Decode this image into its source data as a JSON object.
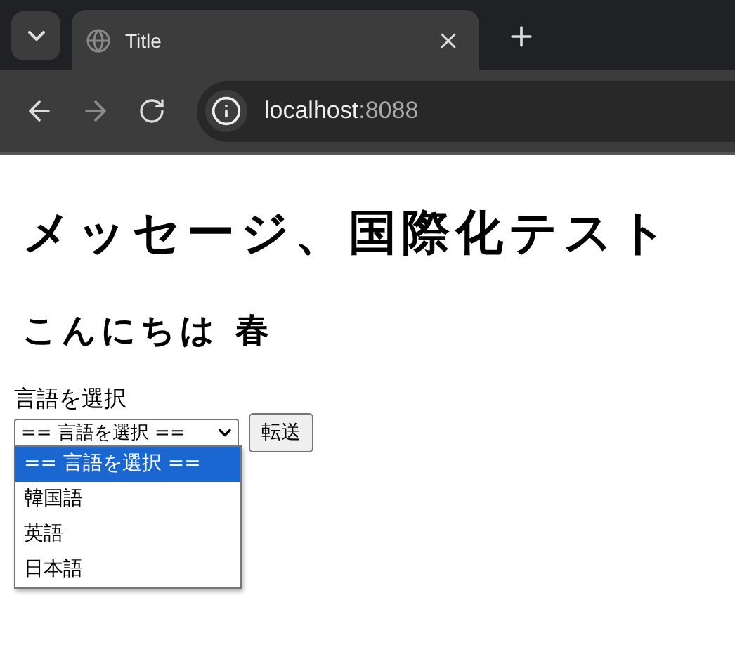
{
  "browser": {
    "tab_title": "Title",
    "url_host": "localhost",
    "url_port": ":8088"
  },
  "page": {
    "heading": "メッセージ、国際化テスト",
    "subheading": "こんにちは 春",
    "label": "言語を選択",
    "select": {
      "value": "== 言語を選択 ==",
      "expanded": true,
      "options": [
        {
          "label": "== 言語を選択 ==",
          "selected": true
        },
        {
          "label": "韓国語",
          "selected": false
        },
        {
          "label": "英語",
          "selected": false
        },
        {
          "label": "日本語",
          "selected": false
        }
      ]
    },
    "submit_button": "転送"
  }
}
